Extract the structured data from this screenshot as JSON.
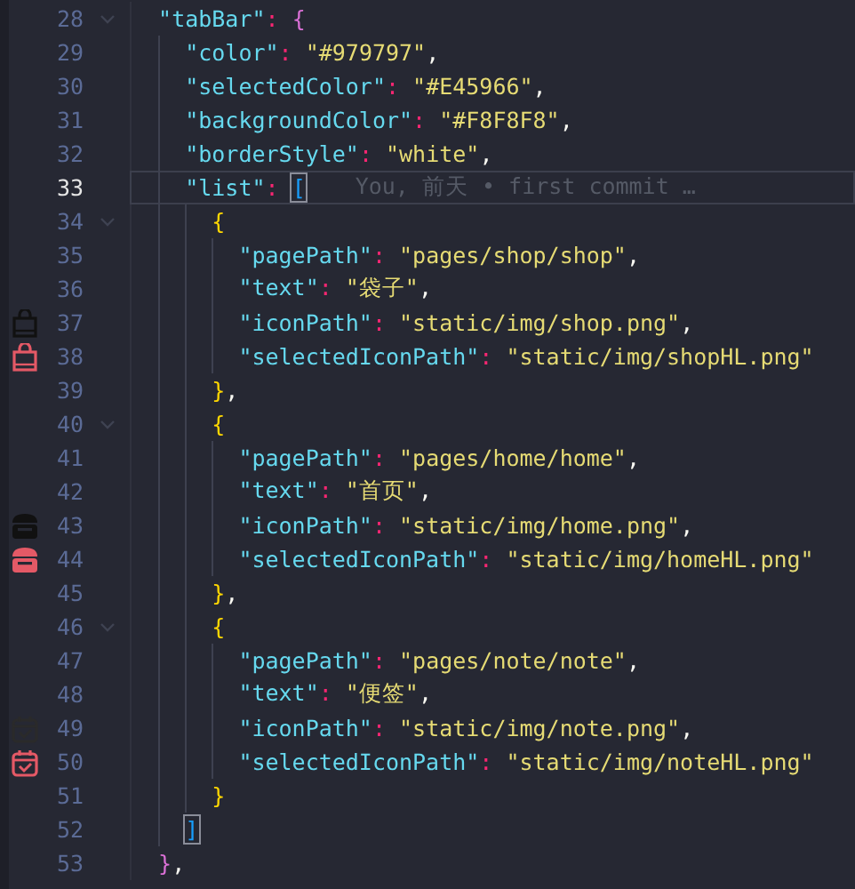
{
  "editor": {
    "lines": [
      {
        "number": "28",
        "current": false,
        "foldable": true,
        "tokens": [
          {
            "kind": "key",
            "t": "\"tabBar\""
          },
          {
            "kind": "colon",
            "t": ": "
          },
          {
            "kind": "open",
            "t": "{",
            "color": "#da70d6",
            "matched": false
          }
        ]
      },
      {
        "number": "29",
        "current": false,
        "foldable": false,
        "tokens": [
          {
            "kind": "key",
            "t": "\"color\""
          },
          {
            "kind": "colon",
            "t": ": "
          },
          {
            "kind": "string",
            "t": "\"#979797\""
          },
          {
            "kind": "comma",
            "t": ","
          }
        ]
      },
      {
        "number": "30",
        "current": false,
        "foldable": false,
        "tokens": [
          {
            "kind": "key",
            "t": "\"selectedColor\""
          },
          {
            "kind": "colon",
            "t": ": "
          },
          {
            "kind": "string",
            "t": "\"#E45966\""
          },
          {
            "kind": "comma",
            "t": ","
          }
        ]
      },
      {
        "number": "31",
        "current": false,
        "foldable": false,
        "tokens": [
          {
            "kind": "key",
            "t": "\"backgroundColor\""
          },
          {
            "kind": "colon",
            "t": ": "
          },
          {
            "kind": "string",
            "t": "\"#F8F8F8\""
          },
          {
            "kind": "comma",
            "t": ","
          }
        ]
      },
      {
        "number": "32",
        "current": false,
        "foldable": false,
        "tokens": [
          {
            "kind": "key",
            "t": "\"borderStyle\""
          },
          {
            "kind": "colon",
            "t": ": "
          },
          {
            "kind": "string",
            "t": "\"white\""
          },
          {
            "kind": "comma",
            "t": ","
          }
        ]
      },
      {
        "number": "33",
        "current": true,
        "foldable": false,
        "tokens": [
          {
            "kind": "key",
            "t": "\"list\""
          },
          {
            "kind": "colon",
            "t": ": "
          },
          {
            "kind": "open",
            "t": "[",
            "color": "#179fff",
            "matched": true
          }
        ],
        "blame": "You, 前天 • first commit …"
      },
      {
        "number": "34",
        "current": false,
        "foldable": true,
        "tokens": [
          {
            "kind": "open",
            "t": "{",
            "color": "#ffd700",
            "matched": false
          }
        ]
      },
      {
        "number": "35",
        "current": false,
        "foldable": false,
        "tokens": [
          {
            "kind": "key",
            "t": "\"pagePath\""
          },
          {
            "kind": "colon",
            "t": ": "
          },
          {
            "kind": "string",
            "t": "\"pages/shop/shop\""
          },
          {
            "kind": "comma",
            "t": ","
          }
        ]
      },
      {
        "number": "36",
        "current": false,
        "foldable": false,
        "tokens": [
          {
            "kind": "key",
            "t": "\"text\""
          },
          {
            "kind": "colon",
            "t": ": "
          },
          {
            "kind": "string",
            "t": "\"袋子\""
          },
          {
            "kind": "comma",
            "t": ","
          }
        ]
      },
      {
        "number": "37",
        "current": false,
        "foldable": false,
        "gutter_icon": {
          "kind": "bag",
          "color": "#111111"
        },
        "tokens": [
          {
            "kind": "key",
            "t": "\"iconPath\""
          },
          {
            "kind": "colon",
            "t": ": "
          },
          {
            "kind": "string",
            "t": "\"static/img/shop.png\""
          },
          {
            "kind": "comma",
            "t": ","
          }
        ]
      },
      {
        "number": "38",
        "current": false,
        "foldable": false,
        "gutter_icon": {
          "kind": "bag",
          "color": "#e45966"
        },
        "tokens": [
          {
            "kind": "key",
            "t": "\"selectedIconPath\""
          },
          {
            "kind": "colon",
            "t": ": "
          },
          {
            "kind": "string",
            "t": "\"static/img/shopHL.png\""
          }
        ]
      },
      {
        "number": "39",
        "current": false,
        "foldable": false,
        "tokens": [
          {
            "kind": "close",
            "t": "}",
            "color": "#ffd700",
            "matched": false
          },
          {
            "kind": "comma",
            "t": ","
          }
        ]
      },
      {
        "number": "40",
        "current": false,
        "foldable": true,
        "tokens": [
          {
            "kind": "open",
            "t": "{",
            "color": "#ffd700",
            "matched": false
          }
        ]
      },
      {
        "number": "41",
        "current": false,
        "foldable": false,
        "tokens": [
          {
            "kind": "key",
            "t": "\"pagePath\""
          },
          {
            "kind": "colon",
            "t": ": "
          },
          {
            "kind": "string",
            "t": "\"pages/home/home\""
          },
          {
            "kind": "comma",
            "t": ","
          }
        ]
      },
      {
        "number": "42",
        "current": false,
        "foldable": false,
        "tokens": [
          {
            "kind": "key",
            "t": "\"text\""
          },
          {
            "kind": "colon",
            "t": ": "
          },
          {
            "kind": "string",
            "t": "\"首页\""
          },
          {
            "kind": "comma",
            "t": ","
          }
        ]
      },
      {
        "number": "43",
        "current": false,
        "foldable": false,
        "gutter_icon": {
          "kind": "shop",
          "color": "#111111"
        },
        "tokens": [
          {
            "kind": "key",
            "t": "\"iconPath\""
          },
          {
            "kind": "colon",
            "t": ": "
          },
          {
            "kind": "string",
            "t": "\"static/img/home.png\""
          },
          {
            "kind": "comma",
            "t": ","
          }
        ]
      },
      {
        "number": "44",
        "current": false,
        "foldable": false,
        "gutter_icon": {
          "kind": "shop",
          "color": "#e45966"
        },
        "tokens": [
          {
            "kind": "key",
            "t": "\"selectedIconPath\""
          },
          {
            "kind": "colon",
            "t": ": "
          },
          {
            "kind": "string",
            "t": "\"static/img/homeHL.png\""
          }
        ]
      },
      {
        "number": "45",
        "current": false,
        "foldable": false,
        "tokens": [
          {
            "kind": "close",
            "t": "}",
            "color": "#ffd700",
            "matched": false
          },
          {
            "kind": "comma",
            "t": ","
          }
        ]
      },
      {
        "number": "46",
        "current": false,
        "foldable": true,
        "tokens": [
          {
            "kind": "open",
            "t": "{",
            "color": "#ffd700",
            "matched": false
          }
        ]
      },
      {
        "number": "47",
        "current": false,
        "foldable": false,
        "tokens": [
          {
            "kind": "key",
            "t": "\"pagePath\""
          },
          {
            "kind": "colon",
            "t": ": "
          },
          {
            "kind": "string",
            "t": "\"pages/note/note\""
          },
          {
            "kind": "comma",
            "t": ","
          }
        ]
      },
      {
        "number": "48",
        "current": false,
        "foldable": false,
        "tokens": [
          {
            "kind": "key",
            "t": "\"text\""
          },
          {
            "kind": "colon",
            "t": ": "
          },
          {
            "kind": "string",
            "t": "\"便签\""
          },
          {
            "kind": "comma",
            "t": ","
          }
        ]
      },
      {
        "number": "49",
        "current": false,
        "foldable": false,
        "gutter_icon": {
          "kind": "calendar",
          "color": "#2a2a2a"
        },
        "tokens": [
          {
            "kind": "key",
            "t": "\"iconPath\""
          },
          {
            "kind": "colon",
            "t": ": "
          },
          {
            "kind": "string",
            "t": "\"static/img/note.png\""
          },
          {
            "kind": "comma",
            "t": ","
          }
        ]
      },
      {
        "number": "50",
        "current": false,
        "foldable": false,
        "gutter_icon": {
          "kind": "calendar",
          "color": "#e45966"
        },
        "tokens": [
          {
            "kind": "key",
            "t": "\"selectedIconPath\""
          },
          {
            "kind": "colon",
            "t": ": "
          },
          {
            "kind": "string",
            "t": "\"static/img/noteHL.png\""
          }
        ]
      },
      {
        "number": "51",
        "current": false,
        "foldable": false,
        "tokens": [
          {
            "kind": "close",
            "t": "}",
            "color": "#ffd700",
            "matched": false
          }
        ]
      },
      {
        "number": "52",
        "current": false,
        "foldable": false,
        "tokens": [
          {
            "kind": "close",
            "t": "]",
            "color": "#179fff",
            "matched": true
          }
        ]
      },
      {
        "number": "53",
        "current": false,
        "foldable": false,
        "tokens": [
          {
            "kind": "close",
            "t": "}",
            "color": "#da70d6",
            "matched": false
          },
          {
            "kind": "comma",
            "t": ","
          }
        ]
      }
    ]
  }
}
